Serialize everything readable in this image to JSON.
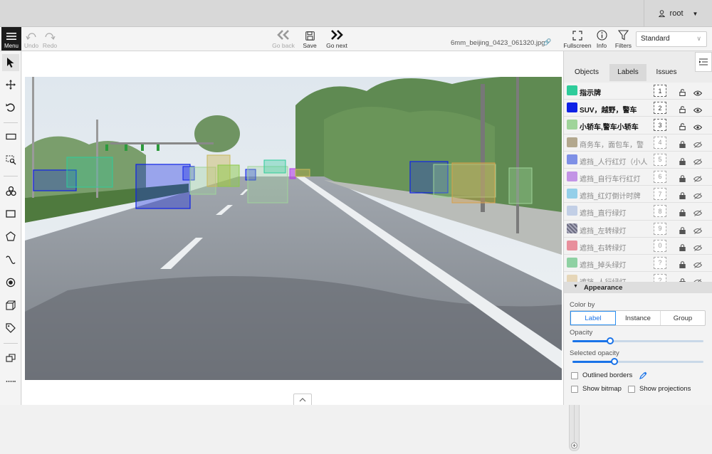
{
  "user": {
    "name": "root"
  },
  "menu": {
    "label": "Menu"
  },
  "toolbar": {
    "undo": "Undo",
    "redo": "Redo",
    "go_back": "Go back",
    "save": "Save",
    "go_next": "Go next",
    "fullscreen": "Fullscreen",
    "info": "Info",
    "filters": "Filters"
  },
  "filename": "6mm_beijing_0423_061320.jpg",
  "workspace": {
    "selected": "Standard"
  },
  "sidebar_tabs": [
    {
      "label": "Objects"
    },
    {
      "label": "Labels",
      "active": true
    },
    {
      "label": "Issues"
    }
  ],
  "labels": [
    {
      "name": "指示牌",
      "key": "1",
      "color": "#2ecc9a",
      "visible": true
    },
    {
      "name": "SUV，越野，警车",
      "key": "2",
      "color": "#0f22e6",
      "visible": true
    },
    {
      "name": "小轿车,警车小轿车",
      "key": "3",
      "color": "#9fd49a",
      "visible": true
    },
    {
      "name": "商务车，面包车，警",
      "key": "4",
      "color": "#b3a88e",
      "visible": false
    },
    {
      "name": "遮挡_人行红灯（小人",
      "key": "5",
      "color": "#7e90e6",
      "visible": false
    },
    {
      "name": "遮挡_自行车行红灯",
      "key": "6",
      "color": "#c394e6",
      "visible": false
    },
    {
      "name": "遮挡_红灯倒计时牌",
      "key": "7",
      "color": "#94cfe9",
      "visible": false
    },
    {
      "name": "遮挡_直行绿灯",
      "key": "8",
      "color": "#c2cfe6",
      "visible": false
    },
    {
      "name": "遮挡_左转绿灯",
      "key": "9",
      "color": "#8a8aa0",
      "visible": false
    },
    {
      "name": "遮挡_右转绿灯",
      "key": "0",
      "color": "#e88f9c",
      "visible": false
    },
    {
      "name": "遮挡_掉头绿灯",
      "key": "?",
      "color": "#8fd1a3",
      "visible": false
    },
    {
      "name": "遮挡_人行绿灯",
      "key": "?",
      "color": "#e6d6b8",
      "visible": false
    }
  ],
  "appearance": {
    "title": "Appearance",
    "color_by_label": "Color by",
    "color_by_options": [
      "Label",
      "Instance",
      "Group"
    ],
    "color_by_selected": "Label",
    "opacity_label": "Opacity",
    "opacity": 0.29,
    "selected_opacity_label": "Selected opacity",
    "selected_opacity": 0.32,
    "outlined_borders": "Outlined borders",
    "show_bitmap": "Show bitmap",
    "show_projections": "Show projections"
  },
  "colors": {
    "accent": "#1a73e8",
    "menu_bg": "#1c1c1c"
  }
}
